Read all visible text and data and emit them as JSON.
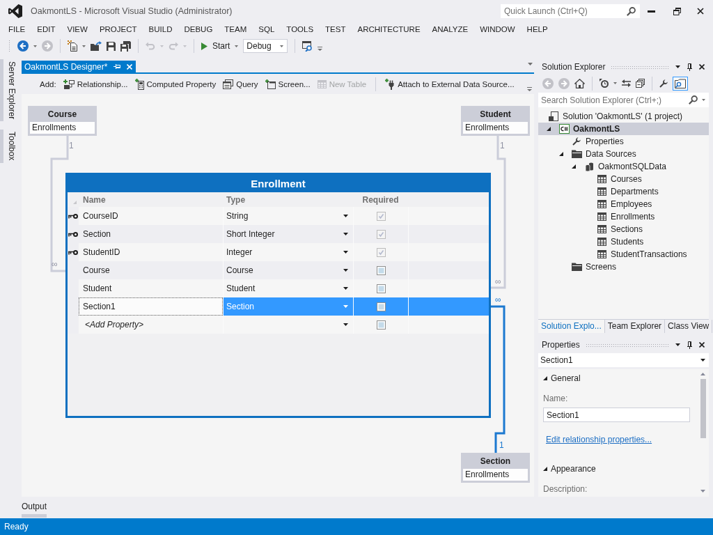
{
  "window": {
    "title": "OakmontLS - Microsoft Visual Studio (Administrator)",
    "quick_launch": {
      "placeholder": "Quick Launch (Ctrl+Q)"
    }
  },
  "menu": [
    "FILE",
    "EDIT",
    "VIEW",
    "PROJECT",
    "BUILD",
    "DEBUG",
    "TEAM",
    "SQL",
    "TOOLS",
    "TEST",
    "ARCHITECTURE",
    "ANALYZE",
    "WINDOW",
    "HELP"
  ],
  "toolbar": {
    "groups": [
      [
        {
          "kind": "back",
          "disabled": false
        },
        {
          "kind": "caret",
          "disabled": false
        },
        {
          "kind": "forward",
          "disabled": true
        }
      ],
      [
        {
          "kind": "new-project",
          "disabled": false
        },
        {
          "kind": "caret",
          "disabled": false
        },
        {
          "kind": "open",
          "disabled": false
        },
        {
          "kind": "save",
          "disabled": false
        },
        {
          "kind": "save-all",
          "disabled": false
        }
      ],
      [
        {
          "kind": "undo",
          "disabled": true
        },
        {
          "kind": "caret",
          "disabled": true
        },
        {
          "kind": "redo",
          "disabled": true
        },
        {
          "kind": "caret",
          "disabled": true
        }
      ],
      [
        {
          "kind": "start",
          "label": "Start",
          "disabled": false
        },
        {
          "kind": "caret",
          "disabled": false
        },
        {
          "kind": "combo",
          "value": "Debug",
          "disabled": false
        }
      ],
      [
        {
          "kind": "find",
          "disabled": false
        }
      ]
    ]
  },
  "side_tabs": [
    {
      "label": "Server Explorer"
    },
    {
      "label": "Toolbox"
    }
  ],
  "document_tabs": [
    {
      "label": "OakmontLS Designer*",
      "selected": true
    }
  ],
  "designer_toolbar": {
    "add_label": "Add:",
    "groups": [
      [
        {
          "kind": "relationship",
          "label": "Relationship...",
          "disabled": false
        },
        {
          "kind": "computed-property",
          "label": "Computed Property",
          "disabled": false
        },
        {
          "kind": "query",
          "label": "Query",
          "disabled": false
        },
        {
          "kind": "screen",
          "label": "Screen...",
          "disabled": false
        },
        {
          "kind": "table",
          "label": "New Table",
          "disabled": true
        }
      ],
      [
        {
          "kind": "external-data",
          "label": "Attach to External Data Source...",
          "disabled": false
        }
      ]
    ]
  },
  "diagram": {
    "related_entities": [
      {
        "name": "Course",
        "navigation": "Enrollments",
        "selected": false,
        "one_label": "1",
        "many_label": "∞"
      },
      {
        "name": "Student",
        "navigation": "Enrollments",
        "selected": false,
        "one_label": "1",
        "many_label": "∞"
      },
      {
        "name": "Section",
        "navigation": "Enrollments",
        "selected": true,
        "one_label": "1",
        "many_label": "∞"
      }
    ],
    "entity": {
      "title": "Enrollment",
      "columns": [
        "Name",
        "Type",
        "Required"
      ],
      "properties": [
        {
          "kind": "property",
          "name": "CourseID",
          "type": "String",
          "key": true,
          "required": true,
          "required_disabled": true,
          "selected": false
        },
        {
          "kind": "property",
          "name": "Section",
          "type": "Short Integer",
          "key": true,
          "required": true,
          "required_disabled": true,
          "selected": false
        },
        {
          "kind": "property",
          "name": "StudentID",
          "type": "Integer",
          "key": true,
          "required": true,
          "required_disabled": true,
          "selected": false
        },
        {
          "kind": "property",
          "name": "Course",
          "type": "Course",
          "key": false,
          "required": false,
          "required_disabled": false,
          "selected": false
        },
        {
          "kind": "property",
          "name": "Student",
          "type": "Student",
          "key": false,
          "required": false,
          "required_disabled": false,
          "selected": false
        },
        {
          "kind": "property",
          "name": "Section1",
          "type": "Section",
          "key": false,
          "required": false,
          "required_disabled": false,
          "selected": true
        },
        {
          "kind": "new",
          "name": "<Add Property>",
          "key": false,
          "required": false,
          "required_disabled": false,
          "selected": false
        }
      ]
    }
  },
  "solution_explorer": {
    "title": "Solution Explorer",
    "toolbar": [
      [
        {
          "kind": "back",
          "disabled": true,
          "on": false
        },
        {
          "kind": "forward",
          "disabled": true,
          "on": false
        },
        {
          "kind": "home",
          "disabled": false,
          "on": false
        }
      ],
      [
        {
          "kind": "history",
          "disabled": false,
          "on": false
        },
        {
          "kind": "caret",
          "disabled": false,
          "on": false
        },
        {
          "kind": "sync",
          "disabled": false,
          "on": false
        },
        {
          "kind": "collapse",
          "disabled": false,
          "on": false
        }
      ],
      [
        {
          "kind": "properties",
          "disabled": false,
          "on": false
        },
        {
          "kind": "preview",
          "disabled": false,
          "on": true
        }
      ]
    ],
    "search": {
      "placeholder": "Search Solution Explorer (Ctrl+;)"
    },
    "tree": [
      {
        "kind": "solution",
        "label": "Solution 'OakmontLS' (1 project)",
        "selected": false,
        "children": [
          {
            "kind": "project",
            "label": "OakmontLS",
            "expanded": true,
            "selected": true,
            "startup": true,
            "children": [
              {
                "kind": "properties",
                "label": "Properties",
                "selected": false
              },
              {
                "kind": "folder",
                "label": "Data Sources",
                "expanded": true,
                "selected": false,
                "children": [
                  {
                    "kind": "database",
                    "label": "OakmontSQLData",
                    "expanded": true,
                    "selected": false,
                    "children": [
                      {
                        "kind": "table",
                        "label": "Courses",
                        "selected": false
                      },
                      {
                        "kind": "table",
                        "label": "Departments",
                        "selected": false
                      },
                      {
                        "kind": "table",
                        "label": "Employees",
                        "selected": false
                      },
                      {
                        "kind": "table",
                        "label": "Enrollments",
                        "selected": false
                      },
                      {
                        "kind": "table",
                        "label": "Sections",
                        "selected": false
                      },
                      {
                        "kind": "table",
                        "label": "Students",
                        "selected": false
                      },
                      {
                        "kind": "table",
                        "label": "StudentTransactions",
                        "selected": false
                      }
                    ]
                  }
                ]
              },
              {
                "kind": "folder",
                "label": "Screens",
                "selected": false
              }
            ]
          }
        ]
      }
    ]
  },
  "panel_tabs": [
    {
      "label": "Solution Explo...",
      "selected": true
    },
    {
      "label": "Team Explorer",
      "selected": false
    },
    {
      "label": "Class View",
      "selected": false
    }
  ],
  "properties": {
    "title": "Properties",
    "object": "Section1",
    "sections": [
      {
        "title": "General",
        "expanded": true,
        "items": [
          {
            "kind": "text-field",
            "label": "Name:",
            "value": "Section1"
          },
          {
            "kind": "link",
            "label": "Edit relationship properties..."
          }
        ]
      },
      {
        "title": "Appearance",
        "expanded": true,
        "items": [
          {
            "kind": "label",
            "label": "Description:"
          }
        ]
      }
    ]
  },
  "bottom_tabs": [
    {
      "label": "Output"
    }
  ],
  "status_bar": {
    "text": "Ready"
  }
}
